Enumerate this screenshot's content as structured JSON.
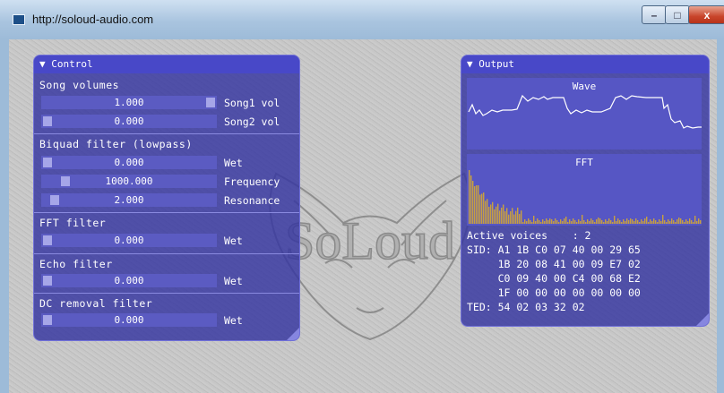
{
  "window": {
    "title": "http://soloud-audio.com",
    "min_glyph": "–",
    "max_glyph": "□",
    "close_glyph": "x"
  },
  "logo_text": "SoLoud",
  "control": {
    "title": "▼ Control",
    "sections": [
      {
        "heading": "Song volumes",
        "sliders": [
          {
            "value": "1.000",
            "label": "Song1 vol",
            "level": 1.0
          },
          {
            "value": "0.000",
            "label": "Song2 vol",
            "level": 0.0
          }
        ]
      },
      {
        "heading": "Biquad filter (lowpass)",
        "sliders": [
          {
            "value": "0.000",
            "label": "Wet",
            "level": 0.0
          },
          {
            "value": "1000.000",
            "label": "Frequency",
            "level": 0.1
          },
          {
            "value": "2.000",
            "label": "Resonance",
            "level": 0.04
          }
        ]
      },
      {
        "heading": "FFT filter",
        "sliders": [
          {
            "value": "0.000",
            "label": "Wet",
            "level": 0.0
          }
        ]
      },
      {
        "heading": "Echo filter",
        "sliders": [
          {
            "value": "0.000",
            "label": "Wet",
            "level": 0.0
          }
        ]
      },
      {
        "heading": "DC removal filter",
        "sliders": [
          {
            "value": "0.000",
            "label": "Wet",
            "level": 0.0
          }
        ]
      }
    ]
  },
  "output": {
    "title": "▼ Output",
    "wave_title": "Wave",
    "fft_title": "FFT",
    "info_lines": [
      "Active voices    : 2",
      "SID: A1 1B C0 07 40 00 29 65",
      "     1B 20 08 41 00 09 E7 02",
      "     C0 09 40 00 C4 00 68 E2",
      "     1F 00 00 00 00 00 00 00",
      "TED: 54 02 03 32 02"
    ]
  },
  "colors": {
    "panel": "#3434a0",
    "header": "#4848c8",
    "slider": "#5b5bc2",
    "plot_line": "#ffffff",
    "fft_bar": "#c8a040"
  }
}
